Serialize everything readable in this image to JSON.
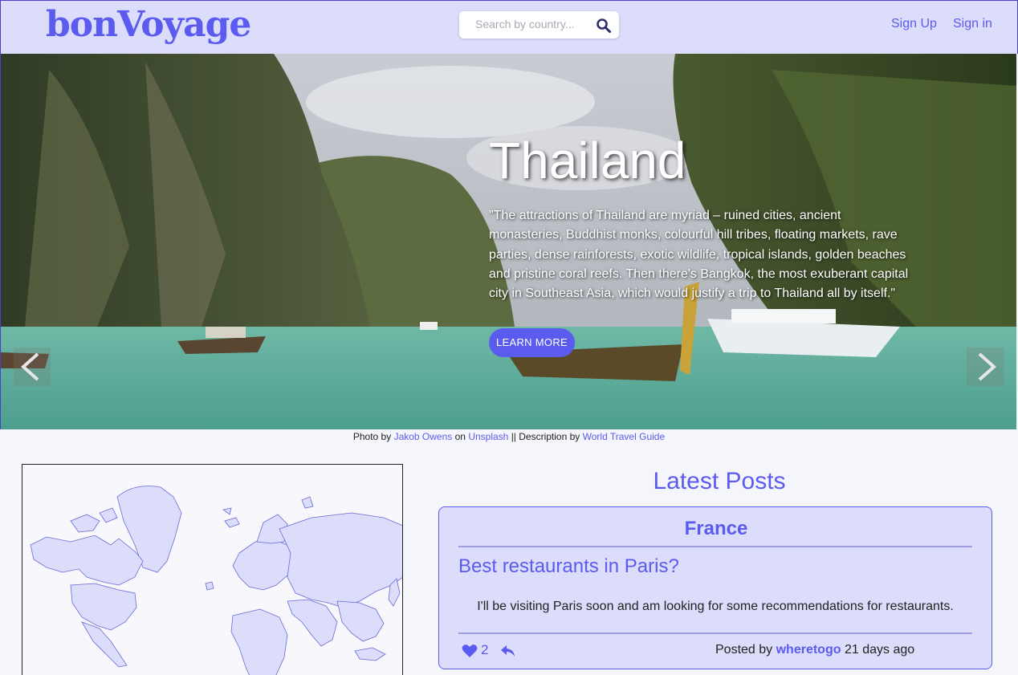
{
  "header": {
    "logo": "bonVoyage",
    "search_placeholder": "Search by country...",
    "sign_up": "Sign Up",
    "sign_in": "Sign in"
  },
  "hero": {
    "title": "Thailand",
    "description": "\"The attractions of Thailand are myriad – ruined cities, ancient monasteries, Buddhist monks, colourful hill tribes, floating markets, rave parties, dense rainforests, exotic wildlife, tropical islands, golden beaches and pristine coral reefs. Then there's Bangkok, the most exuberant capital city in Southeast Asia, which would justify a trip to Thailand all by itself.\"",
    "button": "LEARN MORE",
    "prev_icon": "chevron-left-icon",
    "next_icon": "chevron-right-icon"
  },
  "credit": {
    "photo_by": "Photo by",
    "photographer": "Jakob Owens",
    "on": "on",
    "source": "Unsplash",
    "separator": "|| Description by",
    "desc_source": "World Travel Guide"
  },
  "latest_posts": {
    "heading": "Latest Posts",
    "posts": [
      {
        "country": "France",
        "title": "Best restaurants in Paris?",
        "body": "I'll be visiting Paris soon and am looking for some recommendations for restaurants.",
        "likes": "2",
        "posted_by": "Posted by",
        "author": "wheretogo",
        "age": "21 days ago"
      }
    ]
  },
  "colors": {
    "accent": "#5b5bf0",
    "header_bg": "#dcdcfb",
    "card_bg": "#dcdcfb"
  }
}
